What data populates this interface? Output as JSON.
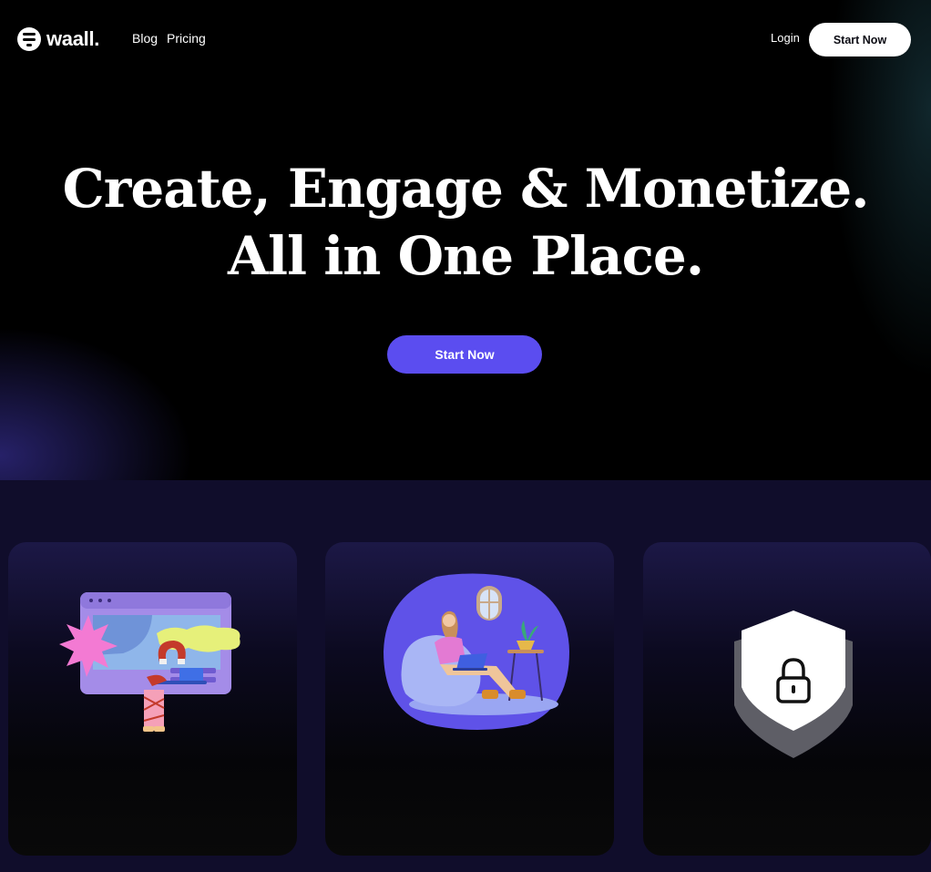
{
  "brand": {
    "name": "waall.",
    "logo_icon": "waall-logo-icon"
  },
  "nav": {
    "links": [
      {
        "label": "Blog"
      },
      {
        "label": "Pricing"
      }
    ],
    "login_label": "Login",
    "cta_label": "Start Now"
  },
  "hero": {
    "headline_line1": "Create, Engage & Monetize.",
    "headline_line2": "All in One Place.",
    "cta_label": "Start Now"
  },
  "features": {
    "cards": [
      {
        "illustration": "creator-illustration"
      },
      {
        "illustration": "relaxing-person-illustration"
      },
      {
        "illustration": "security-shield-lock-icon"
      }
    ]
  },
  "colors": {
    "accent": "#5b4df0",
    "background": "#000000",
    "features_background": "#100d2b",
    "text": "#ffffff"
  }
}
